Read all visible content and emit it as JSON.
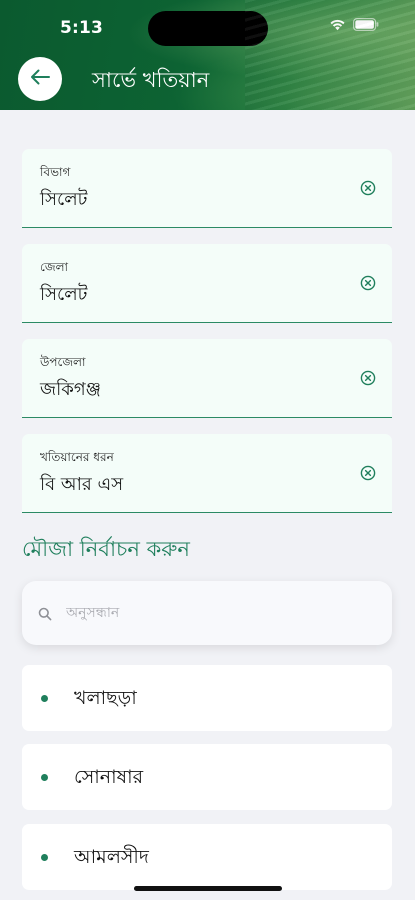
{
  "status_bar": {
    "time": "5:13"
  },
  "header": {
    "title": "সার্ভে খতিয়ান"
  },
  "fields": [
    {
      "label": "বিভাগ",
      "value": "সিলেট"
    },
    {
      "label": "জেলা",
      "value": "সিলেট"
    },
    {
      "label": "উপজেলা",
      "value": "জকিগঞ্জ"
    },
    {
      "label": "খতিয়ানের ধরন",
      "value": "বি আর এস"
    }
  ],
  "mouza_section": {
    "title": "মৌজা নির্বাচন করুন",
    "search_placeholder": "অনুসন্ধান",
    "items": [
      "খলাছড়া",
      "সোনাষার",
      "আমলসীদ"
    ]
  },
  "colors": {
    "accent": "#1f7f5c",
    "header_green": "#0d6333",
    "field_bg": "#f4fdf9",
    "page_bg": "#f1f2f6"
  },
  "icons": {
    "back": "arrow-left-icon",
    "clear": "circle-x-icon",
    "search": "search-icon"
  }
}
